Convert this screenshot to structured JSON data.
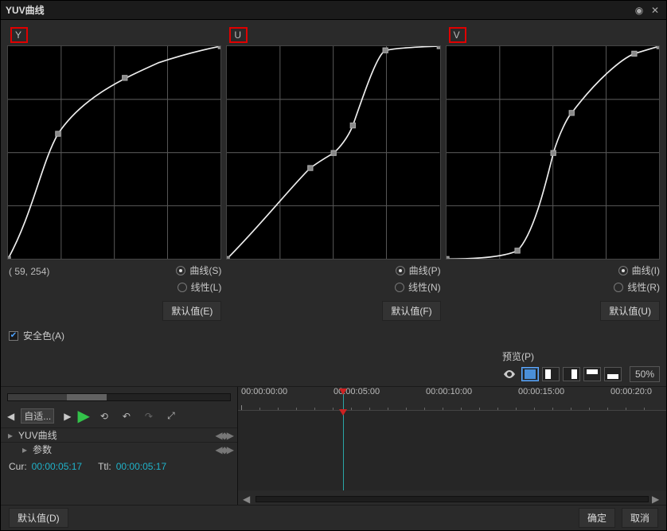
{
  "window": {
    "title": "YUV曲线"
  },
  "panels": {
    "y": {
      "label": "Y",
      "coords": "( 59, 254)",
      "radio_curve": "曲线(S)",
      "radio_linear": "线性(L)",
      "default_btn": "默认值(E)"
    },
    "u": {
      "label": "U",
      "radio_curve": "曲线(P)",
      "radio_linear": "线性(N)",
      "default_btn": "默认值(F)"
    },
    "v": {
      "label": "V",
      "radio_curve": "曲线(I)",
      "radio_linear": "线性(R)",
      "default_btn": "默认值(U)"
    }
  },
  "safe_color": {
    "label": "安全色(A)",
    "checked": true
  },
  "preview": {
    "label": "预览(P)",
    "zoom": "50%"
  },
  "timeline": {
    "dropdown": "自适...",
    "tracks": [
      "YUV曲线",
      "参数"
    ],
    "cur_label": "Cur:",
    "cur_value": "00:00:05:17",
    "ttl_label": "Ttl:",
    "ttl_value": "00:00:05:17",
    "ruler": [
      "00:00:00:00",
      "00:00:05:00",
      "00:00:10:00",
      "00:00:15:00",
      "00:00:20:0"
    ]
  },
  "footer": {
    "default_btn": "默认值(D)",
    "ok": "确定",
    "cancel": "取消"
  },
  "chart_data": [
    {
      "type": "line",
      "name": "Y",
      "xlim": [
        0,
        255
      ],
      "ylim": [
        0,
        255
      ],
      "points": [
        [
          0,
          0
        ],
        [
          60,
          150
        ],
        [
          140,
          217
        ],
        [
          255,
          255
        ]
      ]
    },
    {
      "type": "line",
      "name": "U",
      "xlim": [
        0,
        255
      ],
      "ylim": [
        0,
        255
      ],
      "points": [
        [
          0,
          0
        ],
        [
          100,
          109
        ],
        [
          128,
          128
        ],
        [
          151,
          160
        ],
        [
          190,
          250
        ],
        [
          255,
          255
        ]
      ]
    },
    {
      "type": "line",
      "name": "V",
      "xlim": [
        0,
        255
      ],
      "ylim": [
        0,
        255
      ],
      "points": [
        [
          0,
          0
        ],
        [
          85,
          10
        ],
        [
          128,
          128
        ],
        [
          150,
          175
        ],
        [
          225,
          246
        ],
        [
          255,
          255
        ]
      ]
    }
  ]
}
